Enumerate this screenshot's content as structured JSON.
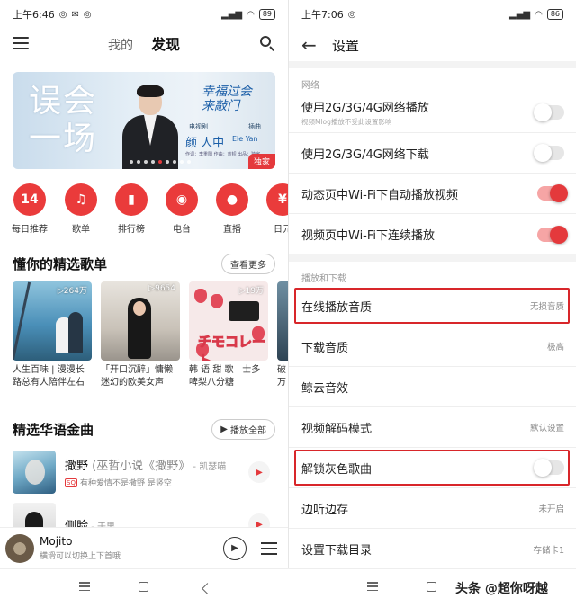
{
  "left": {
    "status": {
      "time": "上午6:46",
      "battery": "89"
    },
    "nav": {
      "tab_mine": "我的",
      "tab_discover": "发现"
    },
    "banner": {
      "big_text_line1": "误会",
      "big_text_line2": "一场",
      "song_title": "幸福过会来敲门",
      "tag_left": "电视剧",
      "tag_right": "插曲",
      "singer": "颜 人中",
      "singer_en": "Ele Yan",
      "credits": "作词：李重阳 作曲：蓝帜 出品：独家",
      "exclusive": "独家"
    },
    "quick_entries": [
      {
        "label": "每日推荐",
        "icon": "14"
      },
      {
        "label": "歌单",
        "icon": "♫"
      },
      {
        "label": "排行榜",
        "icon": "▮"
      },
      {
        "label": "电台",
        "icon": "◉"
      },
      {
        "label": "直播",
        "icon": "●"
      },
      {
        "label": "日元",
        "icon": "¥"
      }
    ],
    "playlists_section": {
      "title": "懂你的精选歌单",
      "more": "查看更多"
    },
    "playlists": [
      {
        "count": "▷264万",
        "name": "人生百味 | 漫漫长路总有人陪伴左右"
      },
      {
        "count": "▷9654",
        "name": "「开口沉醉」慵懒迷幻的欧美女声"
      },
      {
        "count": "▷19万",
        "name": "韩 语 甜 歌 | 士多啤梨八分糖",
        "cover_text": "チモコレート"
      },
      {
        "count": "",
        "name": "破万哪一"
      }
    ],
    "songs_section": {
      "title": "精选华语金曲",
      "play_all": "播放全部"
    },
    "songs": [
      {
        "title": "撒野",
        "subtitle": " (巫哲小说《撒野》",
        "artist": " - 凯瑟喵",
        "tag": "SQ",
        "desc": "有种爱情不是撒野 是竖空"
      },
      {
        "title": "侧脸",
        "subtitle": "",
        "artist": " - 于果",
        "tag": "",
        "desc": ""
      }
    ],
    "mini_player": {
      "title": "Mojito",
      "hint": "横滑可以切换上下首哦"
    }
  },
  "right": {
    "status": {
      "time": "上午7:06",
      "battery": "86"
    },
    "header": {
      "title": "设置"
    },
    "groups": [
      {
        "label": "网络",
        "rows": [
          {
            "label": "使用2G/3G/4G网络播放",
            "sublabel": "视频Mlog播放不受此设置影响",
            "toggle": "off"
          },
          {
            "label": "使用2G/3G/4G网络下载",
            "toggle": "off"
          },
          {
            "label": "动态页中Wi-Fi下自动播放视频",
            "toggle": "on"
          },
          {
            "label": "视频页中Wi-Fi下连续播放",
            "toggle": "on"
          }
        ]
      },
      {
        "label": "播放和下载",
        "rows": [
          {
            "label": "在线播放音质",
            "value": "无损音质",
            "highlighted": true
          },
          {
            "label": "下载音质",
            "value": "极高"
          },
          {
            "label": "鲸云音效"
          },
          {
            "label": "视频解码模式",
            "value": "默认设置"
          },
          {
            "label": "解锁灰色歌曲",
            "toggle": "off",
            "highlighted": true
          },
          {
            "label": "边听边存",
            "value": "未开启"
          },
          {
            "label": "设置下载目录",
            "value": "存储卡1"
          }
        ]
      }
    ]
  },
  "watermark": "头条 @超你呀越",
  "colors": {
    "accent": "#e4393c",
    "highlight_box": "#d8262a"
  }
}
